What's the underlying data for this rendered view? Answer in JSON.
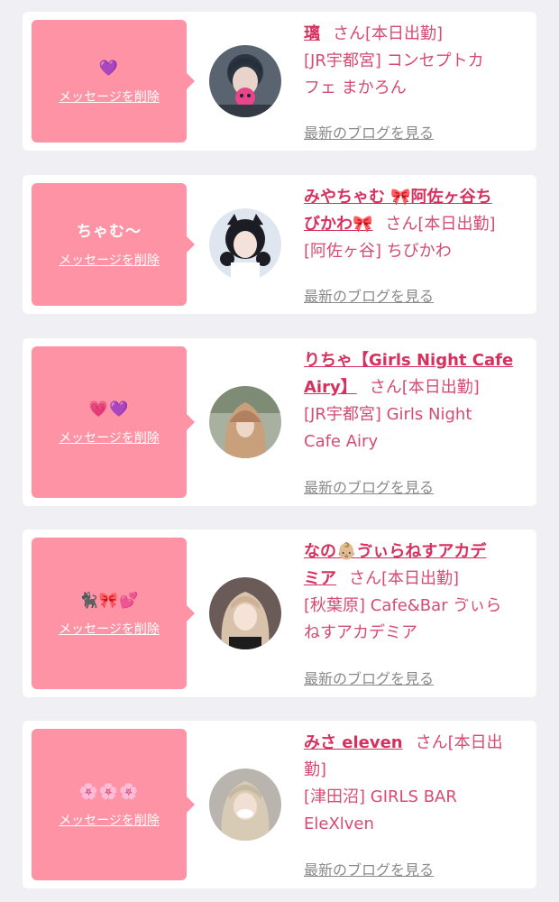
{
  "delete_label": "メッセージを削除",
  "blog_label": "最新のブログを見る",
  "honorific": "さん",
  "status_tag": "[本日出勤]",
  "items": [
    {
      "message": "💜",
      "name": "璃",
      "shop_line_1": "[JR宇都宮] コンセプトカ",
      "shop_line_2": "フェ まかろん"
    },
    {
      "message": "ちゃむ〜",
      "name_line_1": "みやちゃむ 🎀阿佐ヶ谷ち",
      "name_line_2": "びかわ🎀",
      "shop_line_1": "[阿佐ヶ谷] ちびかわ"
    },
    {
      "message": "💗💜",
      "name_line_1": "りちゃ【Girls Night Cafe",
      "name_line_2": "Airy】",
      "shop_line_1": "[JR宇都宮] Girls Night",
      "shop_line_2": "Cafe Airy"
    },
    {
      "message": "🐈‍⬛🎀💕",
      "name_line_1": "なの👶🏼ゔぃらねすアカデ",
      "name_line_2": "ミア",
      "shop_line_1": "[秋葉原] Cafe&Bar ゔぃら",
      "shop_line_2": "ねすアカデミア"
    },
    {
      "message": "🌸🌸🌸",
      "name": "みさ eleven",
      "status_line_1": "[本日出",
      "status_line_2": "勤]",
      "shop_line_1": "[津田沼] GIRLS BAR",
      "shop_line_2": "EleXlven"
    }
  ],
  "colors": {
    "background": "#efeff4",
    "bubble": "#fd93a4",
    "name_link": "#d6305e",
    "text_pink": "#d64b73",
    "blog_link": "#8a8a8a"
  }
}
